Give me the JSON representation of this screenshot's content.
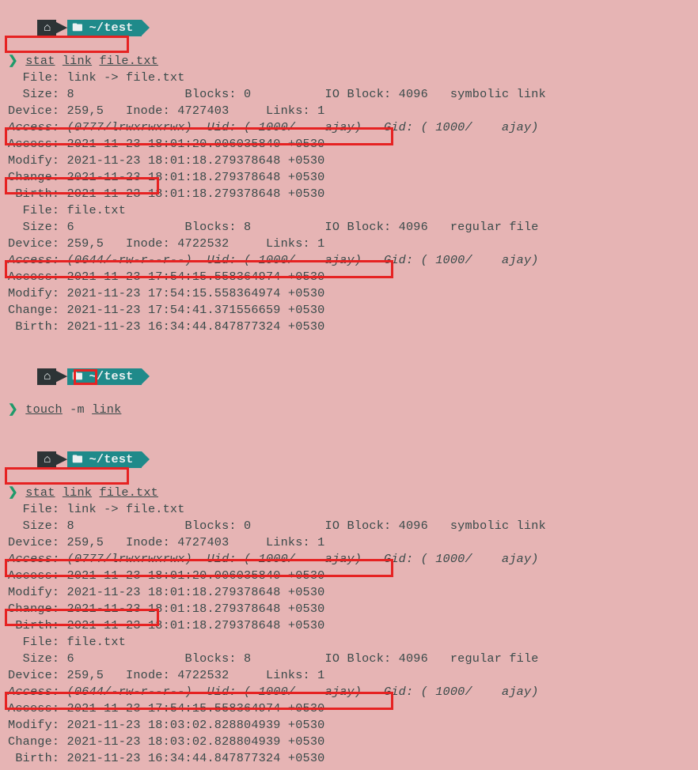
{
  "prompt_path": "~/test",
  "prompt_symbol": "❯",
  "block1": {
    "cmd": "stat link file.txt",
    "cmd_parts": {
      "p0": "stat",
      "p1": "link",
      "p2": "file.txt"
    },
    "l01": "  File: link -> file.txt",
    "l02": "  Size: 8               Blocks: 0          IO Block: 4096   symbolic link",
    "l03": "Device: 259,5   Inode: 4727403     Links: 1",
    "l04": "Access: (0777/lrwxrwxrwx)  Uid: ( 1000/    ajay)   Gid: ( 1000/    ajay)",
    "l05": "Access: 2021-11-23 18:01:20.006035840 +0530",
    "l06": "Modify: 2021-11-23 18:01:18.279378648 +0530",
    "l07": "Change: 2021-11-23 18:01:18.279378648 +0530",
    "l08": " Birth: 2021-11-23 18:01:18.279378648 +0530",
    "l09": "  File: file.txt",
    "l10": "  Size: 6               Blocks: 8          IO Block: 4096   regular file",
    "l11": "Device: 259,5   Inode: 4722532     Links: 1",
    "l12": "Access: (0644/-rw-r--r--)  Uid: ( 1000/    ajay)   Gid: ( 1000/    ajay)",
    "l13": "Access: 2021-11-23 17:54:15.558364974 +0530",
    "l14": "Modify: 2021-11-23 17:54:15.558364974 +0530",
    "l15": "Change: 2021-11-23 17:54:41.371556659 +0530",
    "l16": " Birth: 2021-11-23 16:34:44.847877324 +0530"
  },
  "block2": {
    "cmd": "touch -m link",
    "cmd_parts": {
      "p0": "touch",
      "p1": "-m",
      "p2": "link"
    }
  },
  "block3": {
    "cmd": "stat link file.txt",
    "cmd_parts": {
      "p0": "stat",
      "p1": "link",
      "p2": "file.txt"
    },
    "l01": "  File: link -> file.txt",
    "l02": "  Size: 8               Blocks: 0          IO Block: 4096   symbolic link",
    "l03": "Device: 259,5   Inode: 4727403     Links: 1",
    "l04": "Access: (0777/lrwxrwxrwx)  Uid: ( 1000/    ajay)   Gid: ( 1000/    ajay)",
    "l05": "Access: 2021-11-23 18:01:20.006035840 +0530",
    "l06": "Modify: 2021-11-23 18:01:18.279378648 +0530",
    "l07": "Change: 2021-11-23 18:01:18.279378648 +0530",
    "l08": " Birth: 2021-11-23 18:01:18.279378648 +0530",
    "l09": "  File: file.txt",
    "l10": "  Size: 6               Blocks: 8          IO Block: 4096   regular file",
    "l11": "Device: 259,5   Inode: 4722532     Links: 1",
    "l12": "Access: (0644/-rw-r--r--)  Uid: ( 1000/    ajay)   Gid: ( 1000/    ajay)",
    "l13": "Access: 2021-11-23 17:54:15.558364974 +0530",
    "l14": "Modify: 2021-11-23 18:03:02.828804939 +0530",
    "l15": "Change: 2021-11-23 18:03:02.828804939 +0530",
    "l16": " Birth: 2021-11-23 16:34:44.847877324 +0530"
  }
}
